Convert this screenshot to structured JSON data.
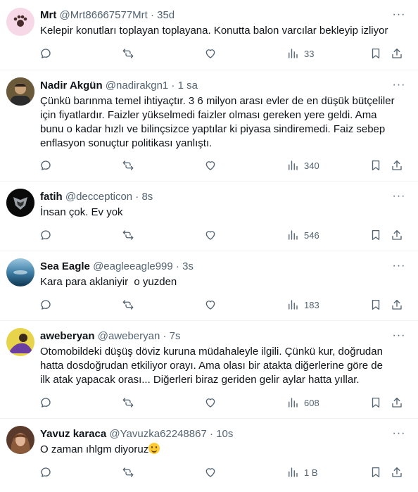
{
  "tweets": [
    {
      "name": "Mrt",
      "handle": "@Mrt86667577Mrt",
      "time": "35d",
      "text": [
        "Kelepir konutları toplayan toplayana. Konutta balon varcılar bekleyip izliyor"
      ],
      "views": "33"
    },
    {
      "name": "Nadir Akgün",
      "handle": "@nadirakgn1",
      "time": "1 sa",
      "text": [
        "Çünkü barınma temel ihtiyaçtır. 3 6 milyon arası evler de en düşük bütçeliler",
        "için fiyatlardır. Faizler yükselmedi faizler olması gereken yere geldi. Ama",
        "bunu o kadar hızlı ve bilinçsizce yaptılar ki piyasa sindiremedi. Faiz sebep",
        "enflasyon sonuçtur politikası yanlıştı."
      ],
      "views": "340"
    },
    {
      "name": "fatih",
      "handle": "@deccepticon",
      "time": "8s",
      "text": [
        "İnsan çok. Ev yok"
      ],
      "views": "546"
    },
    {
      "name": "Sea Eagle",
      "handle": "@eagleeagle999",
      "time": "3s",
      "text": [
        "Kara para aklaniyir  o yuzden"
      ],
      "views": "183"
    },
    {
      "name": "aweberyan",
      "handle": "@aweberyan",
      "time": "7s",
      "text": [
        "Otomobildeki düşüş döviz kuruna müdahaleyle ilgili. Çünkü kur, doğrudan",
        "hatta dosdoğrudan etkiliyor orayı. Ama olası bir atakta diğerlerine göre de",
        "ilk atak yapacak orası... Diğerleri biraz geriden gelir aylar hatta yıllar."
      ],
      "views": "608"
    },
    {
      "name": "Yavuz karaca",
      "handle": "@Yavuzka62248867",
      "time": "10s",
      "text": [
        "O zaman ıhlgm diyoruz"
      ],
      "views": "1 B"
    }
  ],
  "ui": {
    "separator": "·",
    "more": "···"
  },
  "icons": {
    "reply": "reply-icon",
    "retweet": "retweet-icon",
    "like": "heart-icon",
    "views": "views-chart-icon",
    "bookmark": "bookmark-icon",
    "share": "share-icon"
  },
  "colors": {
    "text": "#0f1419",
    "secondary": "#536471",
    "divider": "#eff3f4",
    "emoji": "#ffcc33"
  }
}
